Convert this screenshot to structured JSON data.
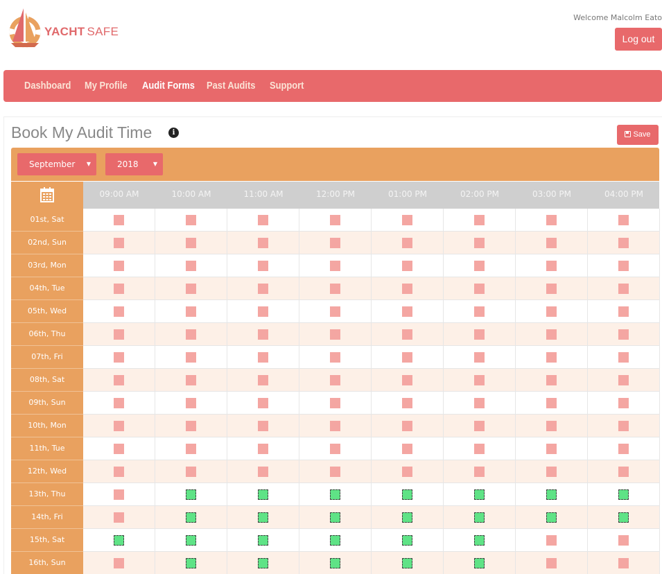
{
  "brand": {
    "name_bold": "YACHT",
    "name_light": "SAFE",
    "colors": {
      "primary": "#e8696b",
      "accent": "#e9a15f",
      "available": "#5fe386",
      "unavailable": "#f4a6a2"
    }
  },
  "header": {
    "welcome": "Welcome Malcolm Eato",
    "logout_label": "Log out"
  },
  "nav": {
    "items": [
      {
        "label": "Dashboard",
        "active": false
      },
      {
        "label": "My Profile",
        "active": false
      },
      {
        "label": "Audit Forms",
        "active": true
      },
      {
        "label": "Past Audits",
        "active": false
      },
      {
        "label": "Support",
        "active": false
      }
    ]
  },
  "page": {
    "title": "Book My Audit Time",
    "info_icon": "info-icon",
    "save_label": "Save"
  },
  "filters": {
    "month": "September",
    "year": "2018"
  },
  "schedule": {
    "times": [
      "09:00 AM",
      "10:00 AM",
      "11:00 AM",
      "12:00 PM",
      "01:00 PM",
      "02:00 PM",
      "03:00 PM",
      "04:00 PM"
    ],
    "days": [
      {
        "label": "01st, Sat",
        "slots": [
          0,
          0,
          0,
          0,
          0,
          0,
          0,
          0
        ]
      },
      {
        "label": "02nd, Sun",
        "slots": [
          0,
          0,
          0,
          0,
          0,
          0,
          0,
          0
        ]
      },
      {
        "label": "03rd, Mon",
        "slots": [
          0,
          0,
          0,
          0,
          0,
          0,
          0,
          0
        ]
      },
      {
        "label": "04th, Tue",
        "slots": [
          0,
          0,
          0,
          0,
          0,
          0,
          0,
          0
        ]
      },
      {
        "label": "05th, Wed",
        "slots": [
          0,
          0,
          0,
          0,
          0,
          0,
          0,
          0
        ]
      },
      {
        "label": "06th, Thu",
        "slots": [
          0,
          0,
          0,
          0,
          0,
          0,
          0,
          0
        ]
      },
      {
        "label": "07th, Fri",
        "slots": [
          0,
          0,
          0,
          0,
          0,
          0,
          0,
          0
        ]
      },
      {
        "label": "08th, Sat",
        "slots": [
          0,
          0,
          0,
          0,
          0,
          0,
          0,
          0
        ]
      },
      {
        "label": "09th, Sun",
        "slots": [
          0,
          0,
          0,
          0,
          0,
          0,
          0,
          0
        ]
      },
      {
        "label": "10th, Mon",
        "slots": [
          0,
          0,
          0,
          0,
          0,
          0,
          0,
          0
        ]
      },
      {
        "label": "11th, Tue",
        "slots": [
          0,
          0,
          0,
          0,
          0,
          0,
          0,
          0
        ]
      },
      {
        "label": "12th, Wed",
        "slots": [
          0,
          0,
          0,
          0,
          0,
          0,
          0,
          0
        ]
      },
      {
        "label": "13th, Thu",
        "slots": [
          0,
          1,
          1,
          1,
          1,
          1,
          1,
          1
        ]
      },
      {
        "label": "14th, Fri",
        "slots": [
          0,
          1,
          1,
          1,
          1,
          1,
          1,
          1
        ]
      },
      {
        "label": "15th, Sat",
        "slots": [
          1,
          1,
          1,
          1,
          1,
          1,
          0,
          0
        ]
      },
      {
        "label": "16th, Sun",
        "slots": [
          0,
          1,
          1,
          1,
          1,
          1,
          0,
          0
        ]
      }
    ]
  }
}
